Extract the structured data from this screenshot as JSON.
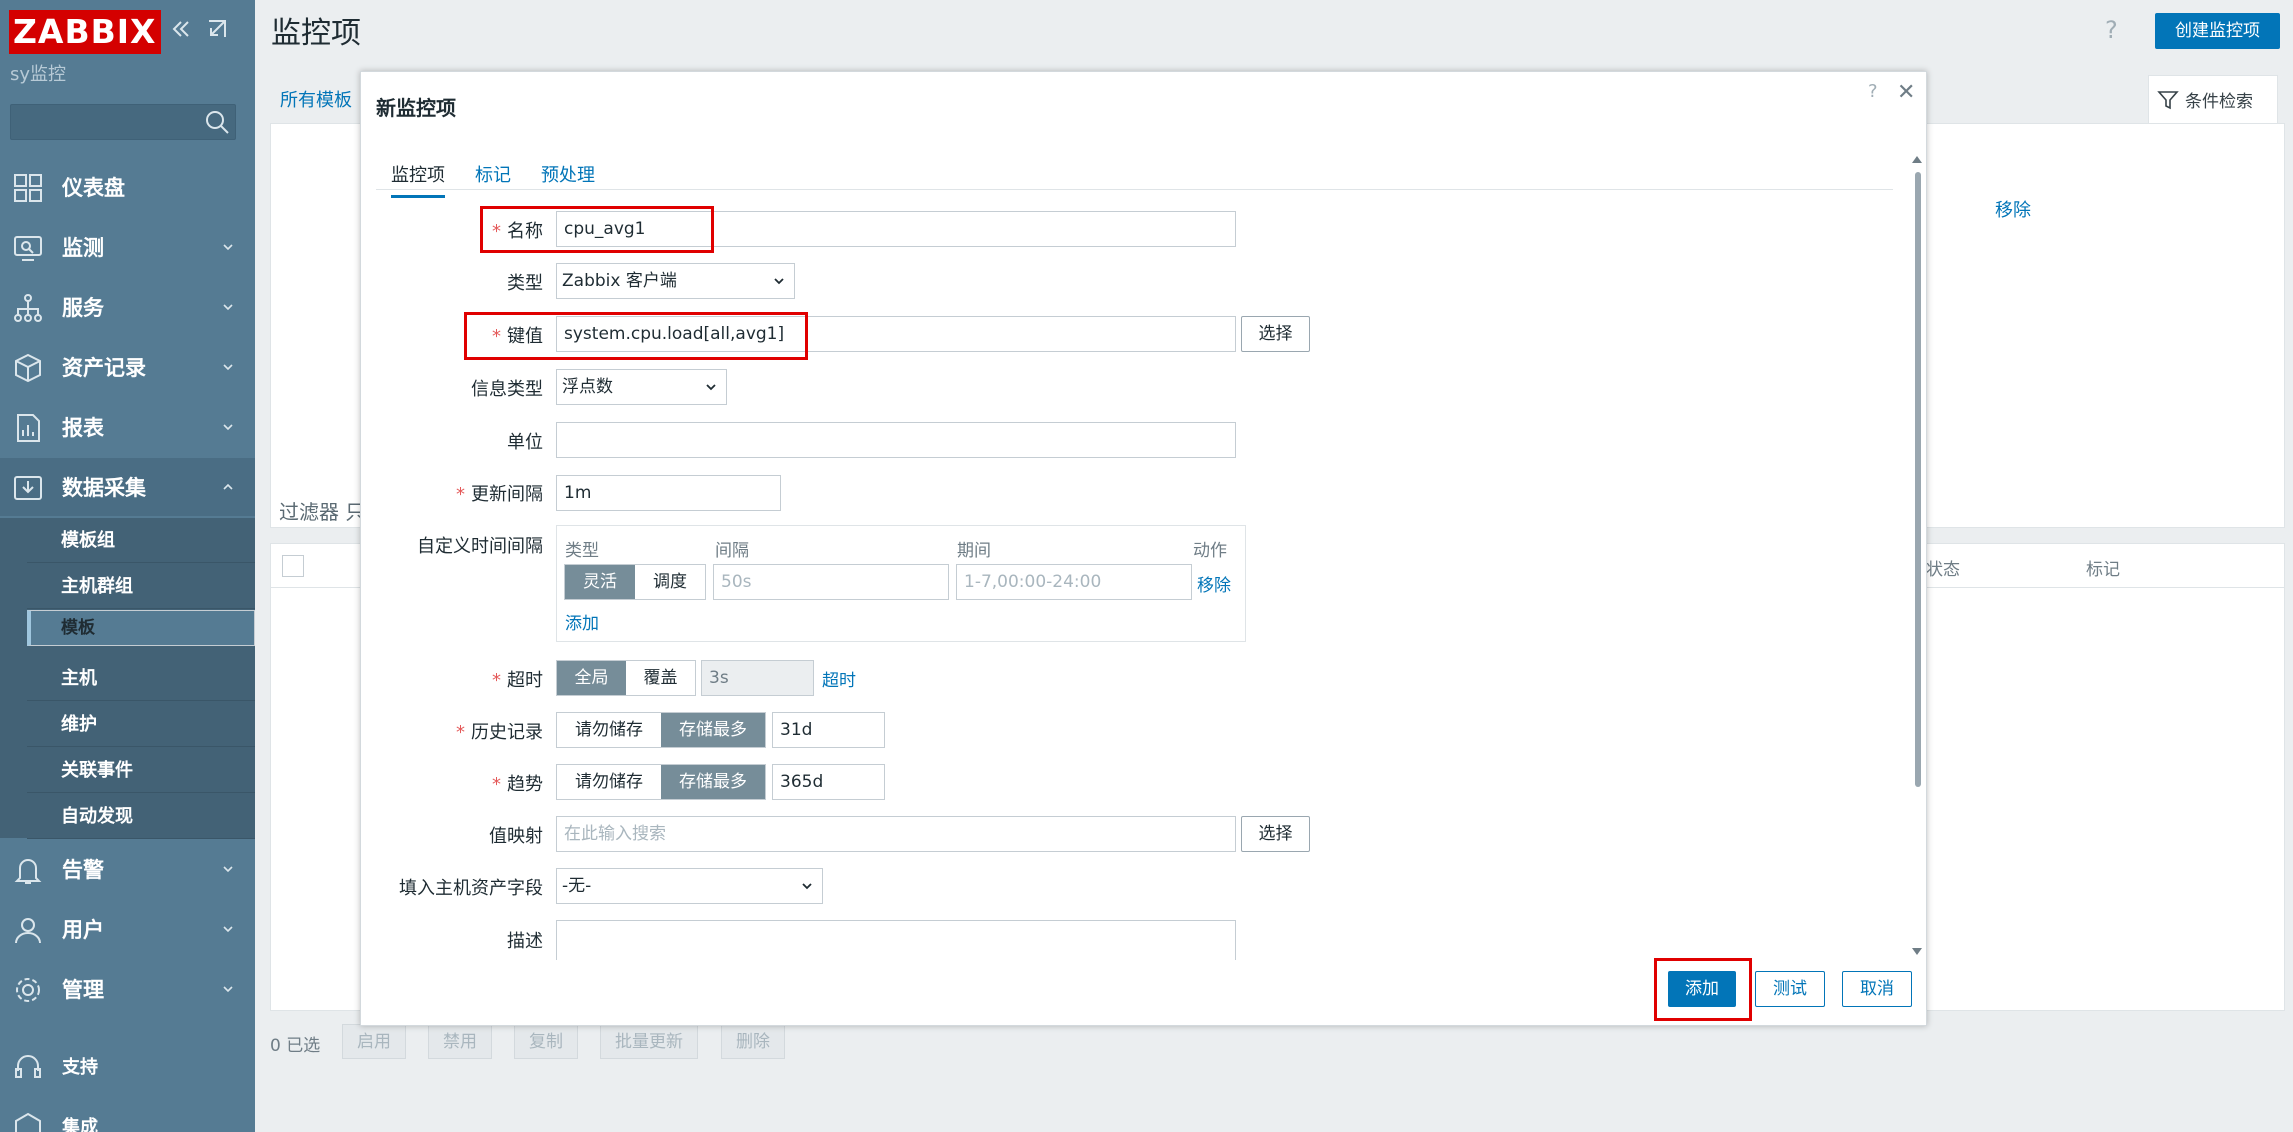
{
  "sidebar": {
    "logo": "ZABBIX",
    "subtitle": "sy监控",
    "menu": [
      {
        "key": "dashboard",
        "label": "仪表盘",
        "icon": "dashboard-icon"
      },
      {
        "key": "monitoring",
        "label": "监测",
        "icon": "monitoring-icon"
      },
      {
        "key": "services",
        "label": "服务",
        "icon": "services-icon"
      },
      {
        "key": "inventory",
        "label": "资产记录",
        "icon": "inventory-icon"
      },
      {
        "key": "reports",
        "label": "报表",
        "icon": "reports-icon"
      },
      {
        "key": "data-collection",
        "label": "数据采集",
        "icon": "data-collection-icon"
      },
      {
        "key": "alerts",
        "label": "告警",
        "icon": "bell-icon"
      },
      {
        "key": "users",
        "label": "用户",
        "icon": "user-icon"
      },
      {
        "key": "administration",
        "label": "管理",
        "icon": "gear-icon"
      },
      {
        "key": "support",
        "label": "支持",
        "icon": "headset-icon"
      },
      {
        "key": "integrations",
        "label": "集成",
        "icon": "integrations-icon"
      }
    ],
    "submenu": [
      "模板组",
      "主机群组",
      "模板",
      "主机",
      "维护",
      "关联事件",
      "自动发现"
    ],
    "submenu_selected": "模板"
  },
  "page": {
    "title": "监控项",
    "help": "?",
    "create_button": "创建监控项",
    "breadcrumb_all_templates": "所有模板",
    "filter_tab": "条件检索",
    "remove_link": "移除",
    "filter_label": "过滤器 只",
    "table_headers": [
      "状态",
      "标记"
    ],
    "selected_count": "0 已选",
    "bulk_buttons": [
      "启用",
      "禁用",
      "复制",
      "批量更新",
      "删除"
    ]
  },
  "modal": {
    "title": "新监控项",
    "help": "?",
    "close": "✕",
    "tabs": [
      "监控项",
      "标记",
      "预处理"
    ],
    "fields": {
      "name": {
        "label": "名称",
        "value": "cpu_avg1"
      },
      "type": {
        "label": "类型",
        "value": "Zabbix 客户端"
      },
      "key": {
        "label": "键值",
        "value": "system.cpu.load[all,avg1]",
        "button": "选择"
      },
      "info_type": {
        "label": "信息类型",
        "value": "浮点数"
      },
      "unit": {
        "label": "单位",
        "value": ""
      },
      "interval": {
        "label": "更新间隔",
        "value": "1m"
      },
      "custom_intervals": {
        "label": "自定义时间间隔",
        "headers": [
          "类型",
          "间隔",
          "期间",
          "动作"
        ],
        "mode_options": [
          "灵活",
          "调度"
        ],
        "mode_selected": "灵活",
        "interval_placeholder": "50s",
        "period_placeholder": "1-7,00:00-24:00",
        "remove": "移除",
        "add": "添加"
      },
      "timeout": {
        "label": "超时",
        "options": [
          "全局",
          "覆盖"
        ],
        "selected": "全局",
        "value": "3s",
        "link": "超时"
      },
      "history": {
        "label": "历史记录",
        "options": [
          "请勿储存",
          "存储最多"
        ],
        "selected": "存储最多",
        "value": "31d"
      },
      "trends": {
        "label": "趋势",
        "options": [
          "请勿储存",
          "存储最多"
        ],
        "selected": "存储最多",
        "value": "365d"
      },
      "value_map": {
        "label": "值映射",
        "placeholder": "在此输入搜索",
        "button": "选择"
      },
      "inventory_field": {
        "label": "填入主机资产字段",
        "value": "-无-"
      },
      "description": {
        "label": "描述",
        "value": ""
      }
    },
    "required_marker": "*",
    "buttons": {
      "add": "添加",
      "test": "测试",
      "cancel": "取消"
    }
  },
  "colors": {
    "accent": "#0275b8",
    "sidebar": "#557b93",
    "highlight": "#e00000",
    "logo": "#d40000"
  }
}
